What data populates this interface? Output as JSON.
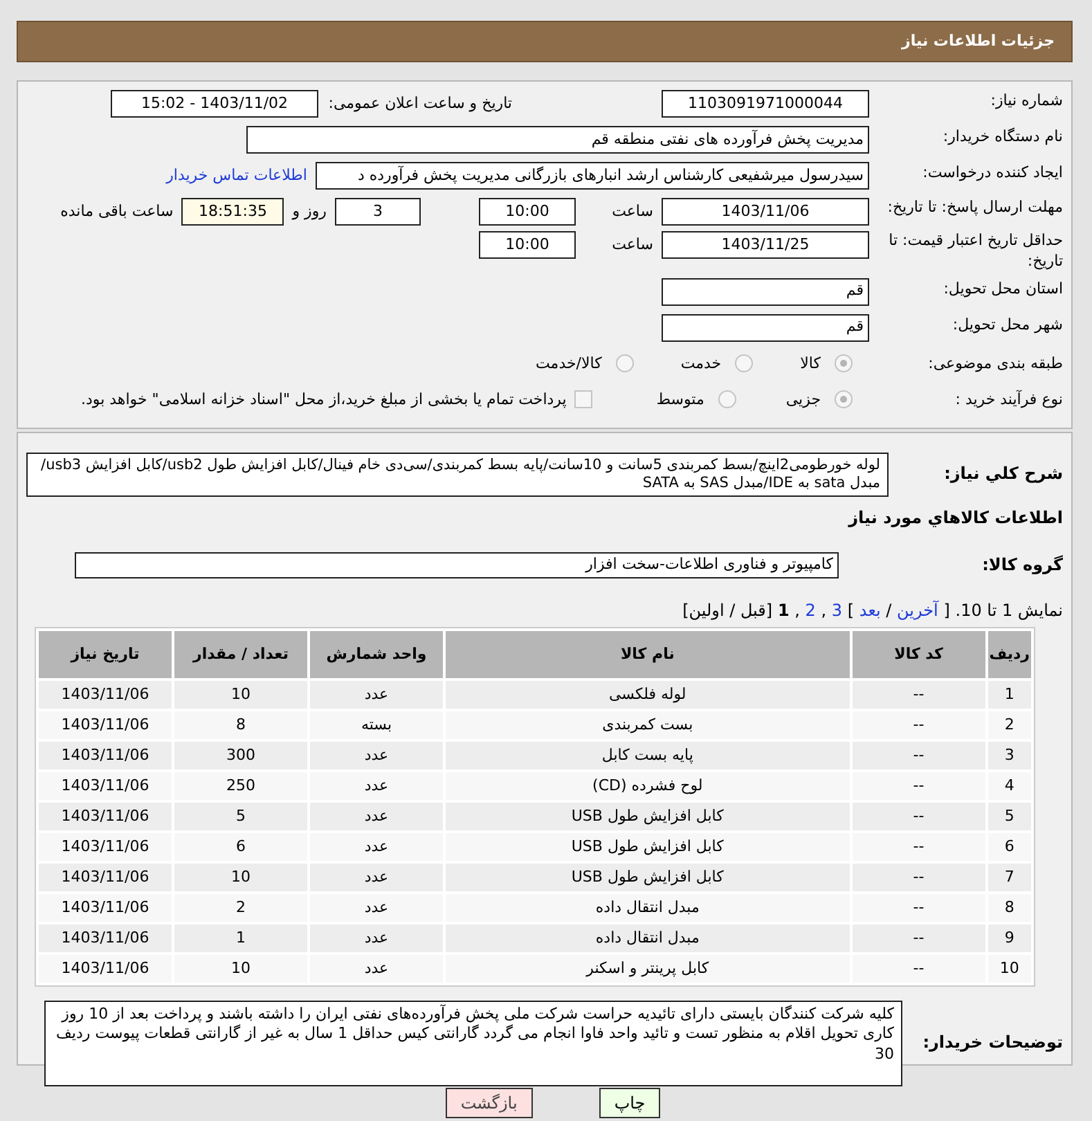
{
  "header": {
    "title": "جزئیات اطلاعات نیاز"
  },
  "need_number": {
    "label": "شماره نیاز:",
    "value": "1103091971000044"
  },
  "announce": {
    "label": "تاریخ و ساعت اعلان عمومی:",
    "value": "1403/11/02 - 15:02"
  },
  "buyer_org": {
    "label": "نام دستگاه خریدار:",
    "value": "مدیریت پخش فرآورده های نفتی منطقه قم"
  },
  "requester": {
    "label": "ایجاد کننده درخواست:",
    "value": "سیدرسول میرشفیعی کارشناس ارشد انبارهای بازرگانی مدیریت پخش فرآورده د",
    "link": "اطلاعات تماس خریدار"
  },
  "deadline": {
    "label": "مهلت ارسال پاسخ: تا تاریخ:",
    "date": "1403/11/06",
    "time_label": "ساعت",
    "time": "10:00",
    "days": "3",
    "days_label": "روز و",
    "remaining": "18:51:35",
    "remaining_label": "ساعت باقی مانده"
  },
  "validity": {
    "label": "حداقل تاریخ اعتبار قیمت: تا تاریخ:",
    "date": "1403/11/25",
    "time_label": "ساعت",
    "time": "10:00"
  },
  "province": {
    "label": "استان محل تحویل:",
    "value": "قم"
  },
  "city": {
    "label": "شهر محل تحویل:",
    "value": "قم"
  },
  "category": {
    "label": "طبقه بندی موضوعی:",
    "options": [
      {
        "label": "کالا",
        "selected": true
      },
      {
        "label": "خدمت",
        "selected": false
      },
      {
        "label": "کالا/خدمت",
        "selected": false
      }
    ]
  },
  "process": {
    "label": "نوع فرآیند خرید :",
    "options": [
      {
        "label": "جزیی",
        "selected": true
      },
      {
        "label": "متوسط",
        "selected": false
      }
    ],
    "payment": {
      "label": "پرداخت تمام یا بخشی از مبلغ خرید،از محل \"اسناد خزانه اسلامی\" خواهد بود.",
      "checked": false
    }
  },
  "description": {
    "label": "شرح کلي نياز:",
    "value": "لوله خورطومی2اینچ/بسط کمربندی 5سانت و 10سانت/پایه بسط کمربندی/سی‌دی خام فینال/کابل افزایش طول usb2/کابل افزایش usb3/مبدل sata به IDE/مبدل SAS به SATA"
  },
  "goods_title": "اطلاعات کالاهاي مورد نياز",
  "group": {
    "label": "گروه کالا:",
    "value": "کامپیوتر و فناوری اطلاعات-سخت افزار"
  },
  "pagination": [
    {
      "kind": "text",
      "text": "نمایش 1 تا 10."
    },
    {
      "kind": "text",
      "text": "["
    },
    {
      "kind": "link",
      "text": "آخرین"
    },
    {
      "kind": "text",
      "text": "/"
    },
    {
      "kind": "link",
      "text": "بعد"
    },
    {
      "kind": "text",
      "text": "]"
    },
    {
      "kind": "link",
      "text": "3"
    },
    {
      "kind": "text",
      "text": ","
    },
    {
      "kind": "link",
      "text": "2"
    },
    {
      "kind": "text",
      "text": ","
    },
    {
      "kind": "current",
      "text": "1"
    },
    {
      "kind": "text",
      "text": "[قبل / اولین]"
    }
  ],
  "table": {
    "columns": [
      "ردیف",
      "کد کالا",
      "نام کالا",
      "واحد شمارش",
      "تعداد / مقدار",
      "تاریخ نیاز"
    ],
    "rows": [
      [
        "1",
        "--",
        "لوله فلکسی",
        "عدد",
        "10",
        "1403/11/06"
      ],
      [
        "2",
        "--",
        "بست کمربندی",
        "بسته",
        "8",
        "1403/11/06"
      ],
      [
        "3",
        "--",
        "پایه بست کابل",
        "عدد",
        "300",
        "1403/11/06"
      ],
      [
        "4",
        "--",
        "لوح فشرده (CD)",
        "عدد",
        "250",
        "1403/11/06"
      ],
      [
        "5",
        "--",
        "کابل افزایش طول USB",
        "عدد",
        "5",
        "1403/11/06"
      ],
      [
        "6",
        "--",
        "کابل افزایش طول USB",
        "عدد",
        "6",
        "1403/11/06"
      ],
      [
        "7",
        "--",
        "کابل افزایش طول USB",
        "عدد",
        "10",
        "1403/11/06"
      ],
      [
        "8",
        "--",
        "مبدل انتقال داده",
        "عدد",
        "2",
        "1403/11/06"
      ],
      [
        "9",
        "--",
        "مبدل انتقال داده",
        "عدد",
        "1",
        "1403/11/06"
      ],
      [
        "10",
        "--",
        "کابل پرینتر و اسکنر",
        "عدد",
        "10",
        "1403/11/06"
      ]
    ]
  },
  "notes": {
    "label": "توضیحات خریدار:",
    "value": "کلیه شرکت کنندگان بایستی دارای تائیدیه حراست شرکت ملی پخش فرآورده‌های نفتی ایران را داشته باشند و پرداخت بعد از 10 روز کاری تحویل اقلام به منظور تست و تائید واحد فاوا انجام می گردد گارانتی کیس حداقل 1 سال به غیر از گارانتی قطعات پیوست ردیف 30"
  },
  "buttons": [
    {
      "kind": "print",
      "label": "چاپ"
    },
    {
      "kind": "back",
      "label": "بازگشت"
    }
  ]
}
